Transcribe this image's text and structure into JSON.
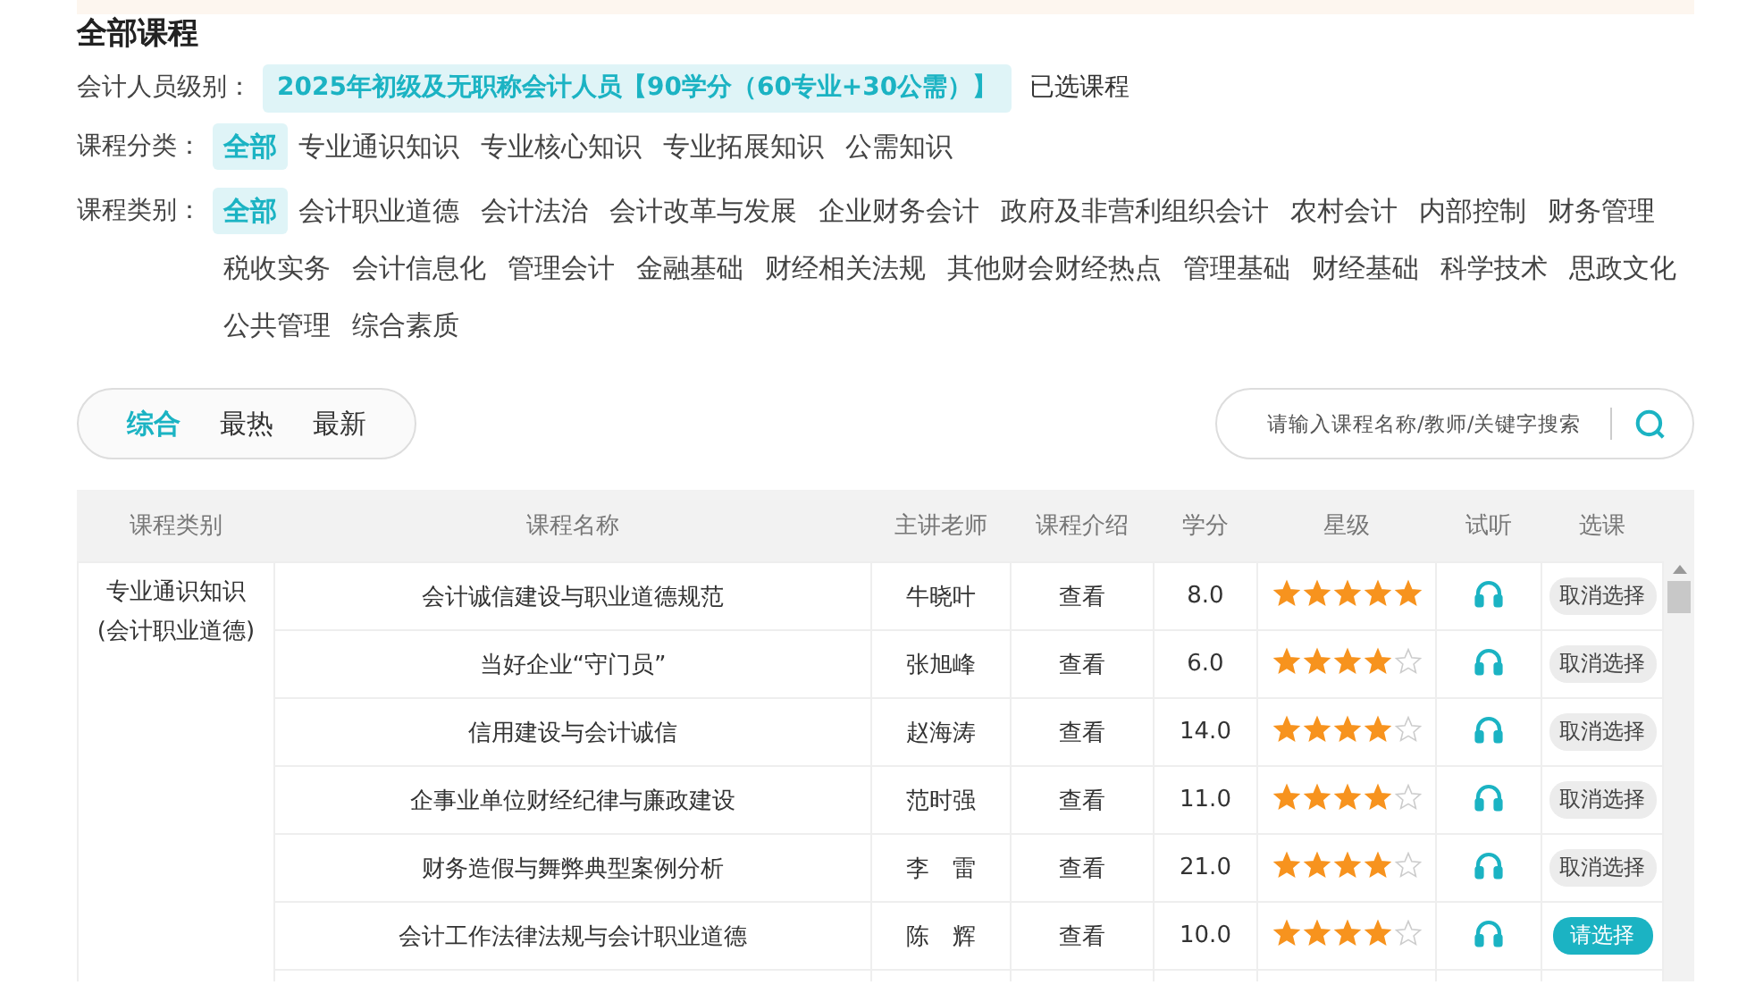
{
  "title": "全部课程",
  "level_filter": {
    "label": "会计人员级别：",
    "value": "2025年初级及无职称会计人员【90学分（60专业+30公需）】",
    "link": "已选课程"
  },
  "classification_filter": {
    "label": "课程分类：",
    "options": [
      {
        "label": "全部",
        "selected": true
      },
      {
        "label": "专业通识知识",
        "selected": false
      },
      {
        "label": "专业核心知识",
        "selected": false
      },
      {
        "label": "专业拓展知识",
        "selected": false
      },
      {
        "label": "公需知识",
        "selected": false
      }
    ]
  },
  "category_filter": {
    "label": "课程类别：",
    "options": [
      {
        "label": "全部",
        "selected": true
      },
      {
        "label": "会计职业道德",
        "selected": false
      },
      {
        "label": "会计法治",
        "selected": false
      },
      {
        "label": "会计改革与发展",
        "selected": false
      },
      {
        "label": "企业财务会计",
        "selected": false
      },
      {
        "label": "政府及非营利组织会计",
        "selected": false
      },
      {
        "label": "农村会计",
        "selected": false
      },
      {
        "label": "内部控制",
        "selected": false
      },
      {
        "label": "财务管理",
        "selected": false
      },
      {
        "label": "税收实务",
        "selected": false
      },
      {
        "label": "会计信息化",
        "selected": false
      },
      {
        "label": "管理会计",
        "selected": false
      },
      {
        "label": "金融基础",
        "selected": false
      },
      {
        "label": "财经相关法规",
        "selected": false
      },
      {
        "label": "其他财会财经热点",
        "selected": false
      },
      {
        "label": "管理基础",
        "selected": false
      },
      {
        "label": "财经基础",
        "selected": false
      },
      {
        "label": "科学技术",
        "selected": false
      },
      {
        "label": "思政文化",
        "selected": false
      },
      {
        "label": "公共管理",
        "selected": false
      },
      {
        "label": "综合素质",
        "selected": false
      }
    ]
  },
  "sort_tabs": [
    {
      "label": "综合",
      "selected": true
    },
    {
      "label": "最热",
      "selected": false
    },
    {
      "label": "最新",
      "selected": false
    }
  ],
  "search": {
    "placeholder": "请输入课程名称/教师/关键字搜索"
  },
  "table": {
    "columns": [
      "课程类别",
      "课程名称",
      "主讲老师",
      "课程介绍",
      "学分",
      "星级",
      "试听",
      "选课"
    ],
    "group": "专业通识知识\n(会计职业道德)",
    "rows": [
      {
        "name": "会计诚信建设与职业道德规范",
        "teacher": "牛晓叶",
        "intro": "查看",
        "credit": "8.0",
        "stars": 5,
        "action": "取消选择",
        "selected": true
      },
      {
        "name": "当好企业“守门员”",
        "teacher": "张旭峰",
        "intro": "查看",
        "credit": "6.0",
        "stars": 4,
        "action": "取消选择",
        "selected": true
      },
      {
        "name": "信用建设与会计诚信",
        "teacher": "赵海涛",
        "intro": "查看",
        "credit": "14.0",
        "stars": 4,
        "action": "取消选择",
        "selected": true
      },
      {
        "name": "企事业单位财经纪律与廉政建设",
        "teacher": "范时强",
        "intro": "查看",
        "credit": "11.0",
        "stars": 4,
        "action": "取消选择",
        "selected": true
      },
      {
        "name": "财务造假与舞弊典型案例分析",
        "teacher": "李　雷",
        "intro": "查看",
        "credit": "21.0",
        "stars": 4,
        "action": "取消选择",
        "selected": true
      },
      {
        "name": "会计工作法律法规与会计职业道德",
        "teacher": "陈　辉",
        "intro": "查看",
        "credit": "10.0",
        "stars": 4,
        "action": "请选择",
        "selected": false
      }
    ]
  }
}
